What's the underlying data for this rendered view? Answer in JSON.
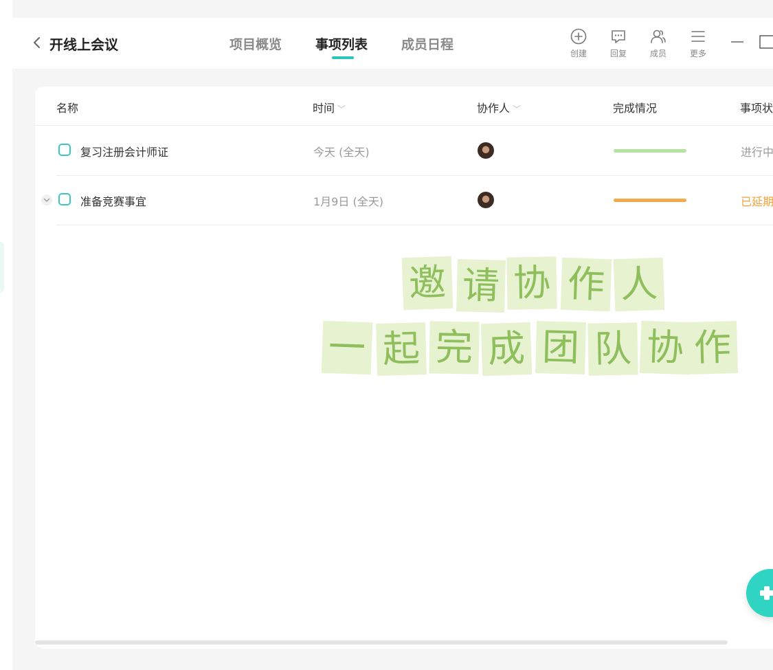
{
  "header": {
    "project_title": "开线上会议",
    "tabs": [
      {
        "label": "项目概览",
        "active": false
      },
      {
        "label": "事项列表",
        "active": true
      },
      {
        "label": "成员日程",
        "active": false
      }
    ],
    "tools": [
      {
        "label": "创建",
        "icon": "plus-circle-icon"
      },
      {
        "label": "回复",
        "icon": "chat-bubble-icon"
      },
      {
        "label": "成员",
        "icon": "members-icon"
      },
      {
        "label": "更多",
        "icon": "menu-icon"
      }
    ],
    "accent_color": "#2bc4b7"
  },
  "table": {
    "columns": [
      {
        "label": "名称",
        "sortable": false
      },
      {
        "label": "时间",
        "sortable": true
      },
      {
        "label": "协作人",
        "sortable": true
      },
      {
        "label": "完成情况",
        "sortable": false
      },
      {
        "label": "事项状",
        "sortable": false
      }
    ],
    "rows": [
      {
        "name": "复习注册会计师证",
        "time": "今天 (全天)",
        "progress_color": "#b5e3a0",
        "status": "进行中",
        "status_color": "#999999",
        "expandable": false
      },
      {
        "name": "准备竞赛事宜",
        "time": "1月9日 (全天)",
        "progress_color": "#f0ab4a",
        "status": "已延期",
        "status_color": "#f0a23e",
        "expandable": true
      }
    ]
  },
  "empty_hint": {
    "line1": [
      "邀",
      "请",
      "协",
      "作",
      "人"
    ],
    "line2": [
      "一",
      "起",
      "完",
      "成",
      "团",
      "队",
      "协",
      "作"
    ]
  },
  "colors": {
    "fab": "#2fd5c2",
    "hint_tile": "#e6f2d0",
    "hint_text": "#8fbf5d"
  }
}
